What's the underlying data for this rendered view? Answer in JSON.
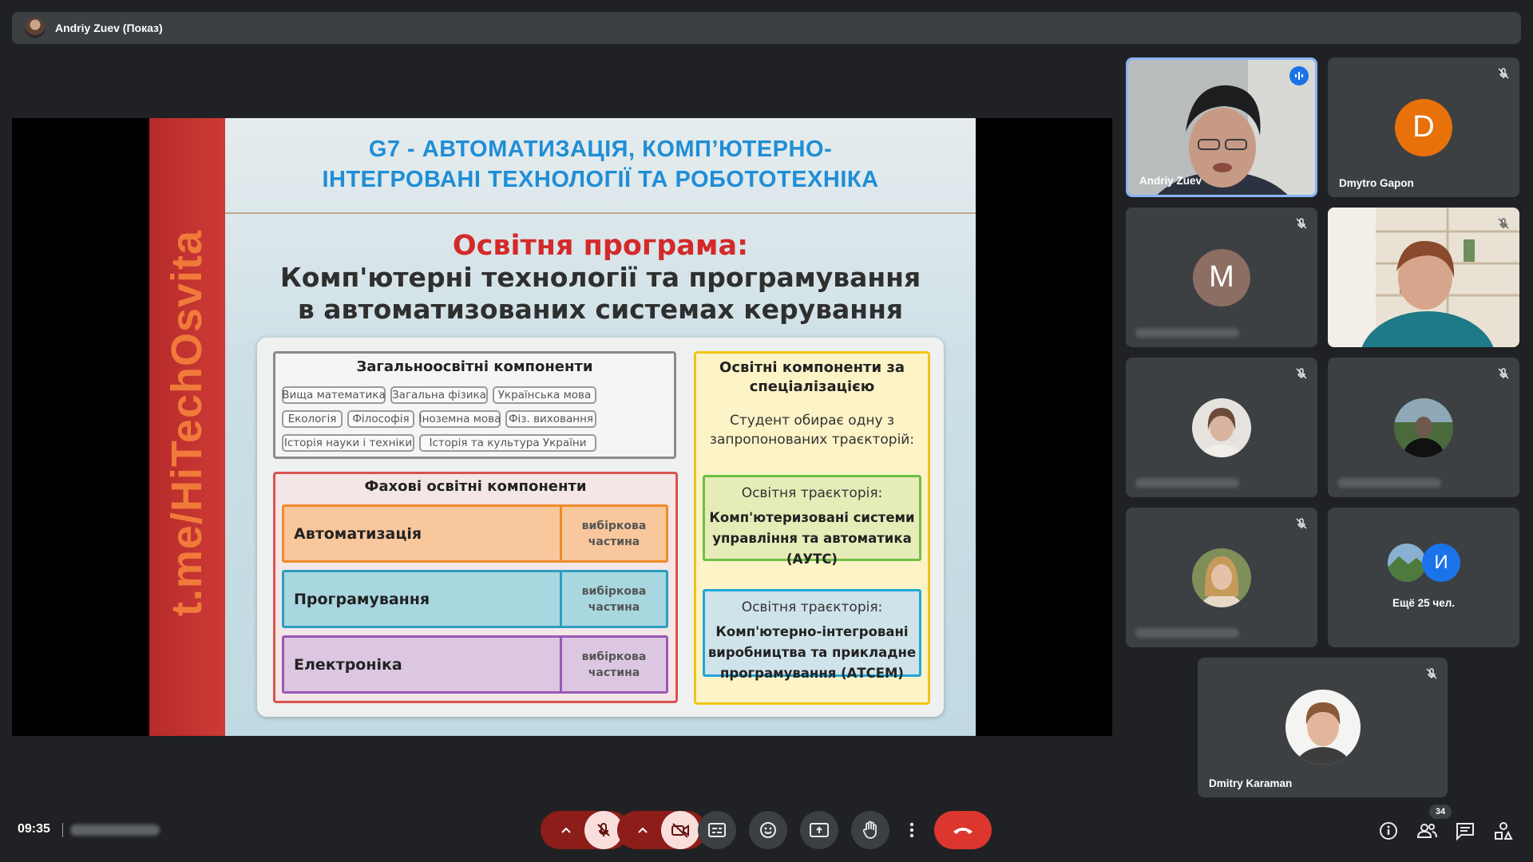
{
  "presenter_bar": {
    "name": "Andriy Zuev (Показ)"
  },
  "slide": {
    "side_text": "t.me/HiTechOsvita",
    "title": "G7 - АВТОМАТИЗАЦІЯ, КОМП’ЮТЕРНО-\nІНТЕГРОВАНІ ТЕХНОЛОГІЇ ТА РОБОТОТЕХНІКА",
    "program_label": "Освітня програма:",
    "program_name": "Комп'ютерні технології та програмування\nв автоматизованих системах керування",
    "general": {
      "title": "Загальноосвітні компоненти",
      "chips": [
        "Вища математика",
        "Загальна фізика",
        "Українська мова",
        "Екологія",
        "Філософія",
        "Іноземна мова",
        "Фіз. виховання",
        "Історія науки і техніки",
        "Історія та культура України"
      ]
    },
    "professional": {
      "title": "Фахові освітні компоненти",
      "rows": [
        {
          "label": "Автоматизація",
          "select": "вибіркова частина"
        },
        {
          "label": "Програмування",
          "select": "вибіркова частина"
        },
        {
          "label": "Електроніка",
          "select": "вибіркова частина"
        }
      ]
    },
    "specialization": {
      "title": "Освітні компоненти за спеціалізацією",
      "text": "Студент обирає одну з запропонованих траєкторій:",
      "trajectories": [
        {
          "label": "Освітня траєкторія:",
          "name": "Комп'ютеризовані системи управління та автоматика (АУТС)"
        },
        {
          "label": "Освітня траєкторія:",
          "name": "Комп'ютерно-інтегровані виробництва та прикладне програмування (АТСЕМ)"
        }
      ]
    }
  },
  "participants": {
    "tiles": [
      {
        "name": "Andriy Zuev"
      },
      {
        "name": "Dmytro Gapon",
        "initial": "D",
        "color": "#e8710a"
      },
      {
        "initial": "M",
        "color": "#8d6e63"
      },
      {
        "more_label": "Ещё 25 чел.",
        "more_initial": "И",
        "more_color": "#1a73e8"
      },
      {
        "name": "Dmitry Karaman"
      }
    ]
  },
  "controls": {
    "time": "09:35",
    "participant_count": "34"
  },
  "colors": {
    "accent_blue": "#8ab4f8",
    "hangup_red": "#dc362e",
    "mic_off_bg": "#f9dedc"
  }
}
